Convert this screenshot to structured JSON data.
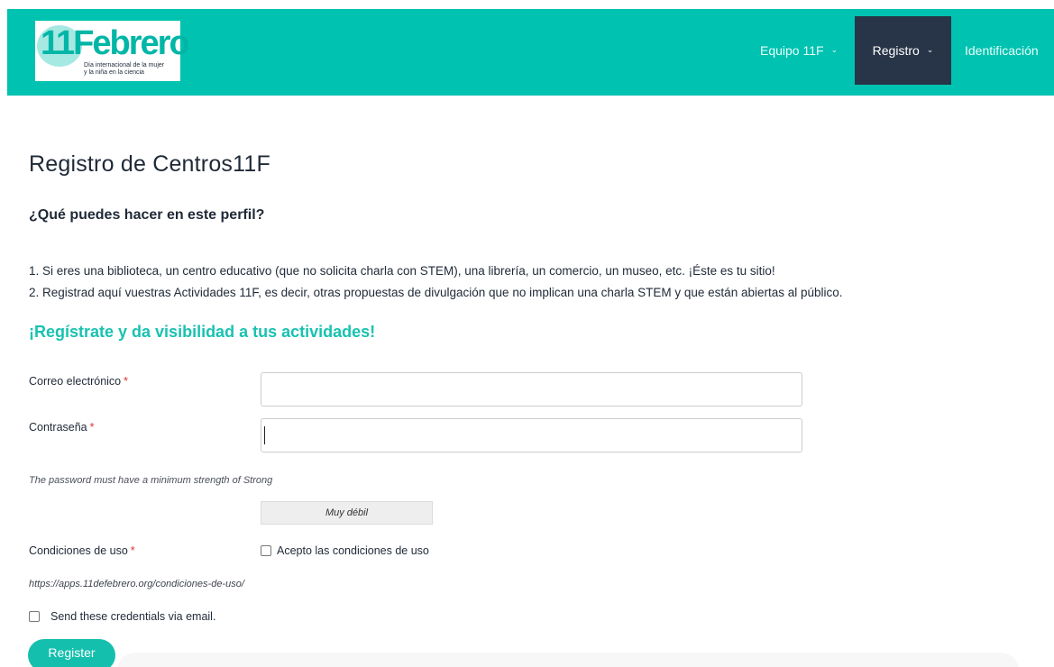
{
  "header": {
    "logo": {
      "text": "11Febrero",
      "subtitle_line1": "Día internacional de la mujer",
      "subtitle_line2": "y la niña en la ciencia",
      "brand_color": "#00c2b0"
    },
    "nav": [
      {
        "label": "Equipo 11F",
        "icon": "chevron-down-icon",
        "active": false
      },
      {
        "label": "Registro",
        "icon": "chevron-down-icon",
        "active": true
      },
      {
        "label": "Identificación",
        "active": false
      }
    ],
    "active_color": "#283447"
  },
  "main": {
    "title": "Registro de Centros11F",
    "subheading": "¿Qué puedes hacer en este perfil?",
    "items": [
      "1. Si eres una biblioteca, un centro educativo (que no solicita charla con STEM), una librería, un comercio, un museo, etc. ¡Éste es tu sitio!",
      "2. Registrad aquí vuestras Actividades 11F, es decir, otras propuestas de divulgación que no implican una charla STEM y que están abiertas al público."
    ],
    "cta": "¡Regístrate y da visibilidad a tus actividades!"
  },
  "form": {
    "email_label": "Correo electrónico",
    "email_value": "",
    "password_label": "Contraseña",
    "password_value": "",
    "required_mark": "*",
    "password_hint": "The password must have a minimum strength of Strong",
    "strength_text": "Muy débil",
    "terms_label": "Condiciones de uso",
    "terms_checkbox_label": "Acepto las condiciones de uso",
    "terms_checked": false,
    "terms_url": "https://apps.11defebrero.org/condiciones-de-uso/",
    "send_credentials_label": "Send these credentials via email.",
    "send_credentials_checked": false,
    "register_label": "Register"
  }
}
